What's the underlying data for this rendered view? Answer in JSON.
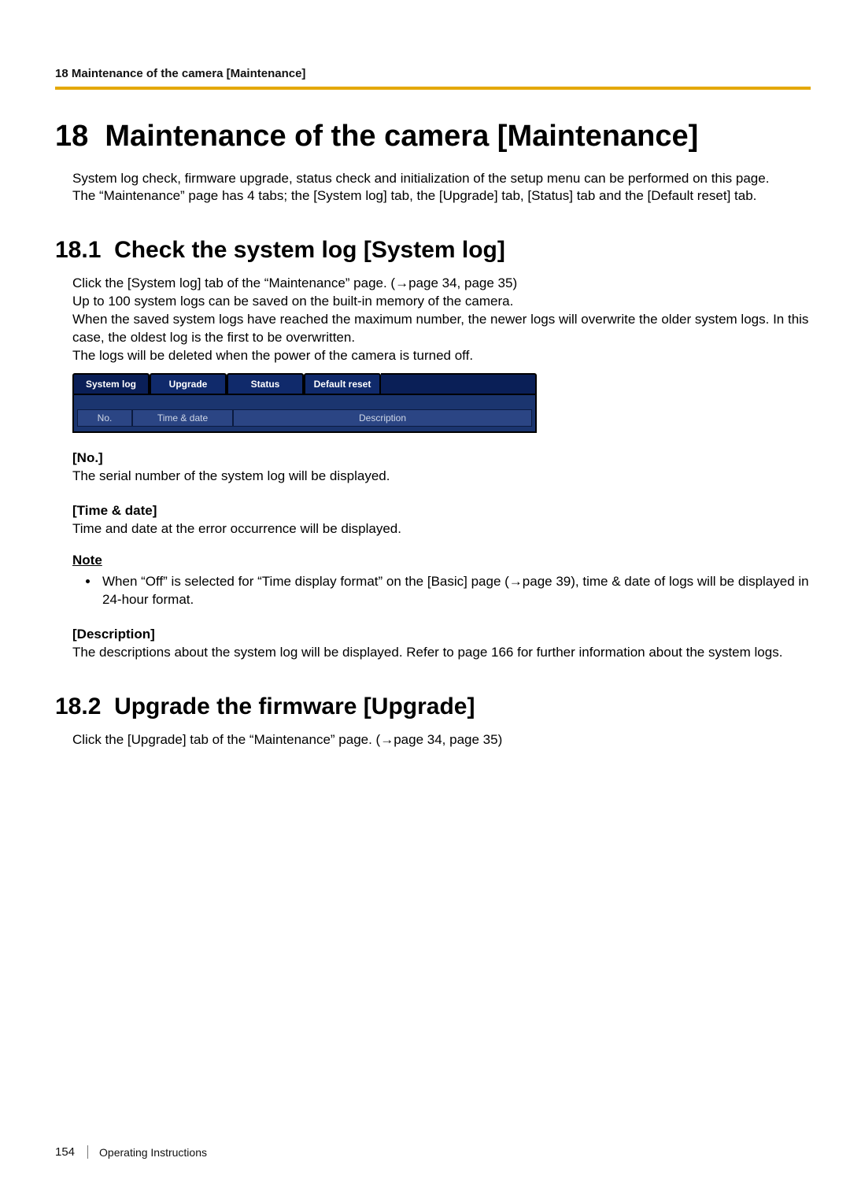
{
  "header": {
    "running": "18 Maintenance of the camera [Maintenance]"
  },
  "chapter": {
    "number": "18",
    "title": "Maintenance of the camera [Maintenance]"
  },
  "intro": {
    "p1": "System log check, firmware upgrade, status check and initialization of the setup menu can be performed on this page.",
    "p2": "The “Maintenance” page has 4 tabs; the [System log] tab, the [Upgrade] tab, [Status] tab and the [Default reset] tab."
  },
  "section1": {
    "number": "18.1",
    "title": "Check the system log [System log]",
    "p1": "Click the [System log] tab of the “Maintenance” page. (→page 34, page 35)",
    "p2": "Up to 100 system logs can be saved on the built-in memory of the camera.",
    "p3": "When the saved system logs have reached the maximum number, the newer logs will overwrite the older system logs. In this case, the oldest log is the first to be overwritten.",
    "p4": "The logs will be deleted when the power of the camera is turned off.",
    "ui": {
      "tabs": [
        "System log",
        "Upgrade",
        "Status",
        "Default reset"
      ],
      "active_tab_index": 0,
      "columns": {
        "no": "No.",
        "time_date": "Time & date",
        "description": "Description"
      }
    },
    "fields": {
      "no": {
        "label": "[No.]",
        "desc": "The serial number of the system log will be displayed."
      },
      "time_date": {
        "label": "[Time & date]",
        "desc": "Time and date at the error occurrence will be displayed."
      },
      "description": {
        "label": "[Description]",
        "desc": "The descriptions about the system log will be displayed. Refer to page 166 for further information about the system logs."
      }
    },
    "note": {
      "head": "Note",
      "item": "When “Off” is selected for “Time display format” on the [Basic] page (→page 39), time & date of logs will be displayed in 24-hour format."
    }
  },
  "section2": {
    "number": "18.2",
    "title": "Upgrade the firmware [Upgrade]",
    "p1": "Click the [Upgrade] tab of the “Maintenance” page. (→page 34, page 35)"
  },
  "footer": {
    "page_number": "154",
    "doc_label": "Operating Instructions"
  }
}
